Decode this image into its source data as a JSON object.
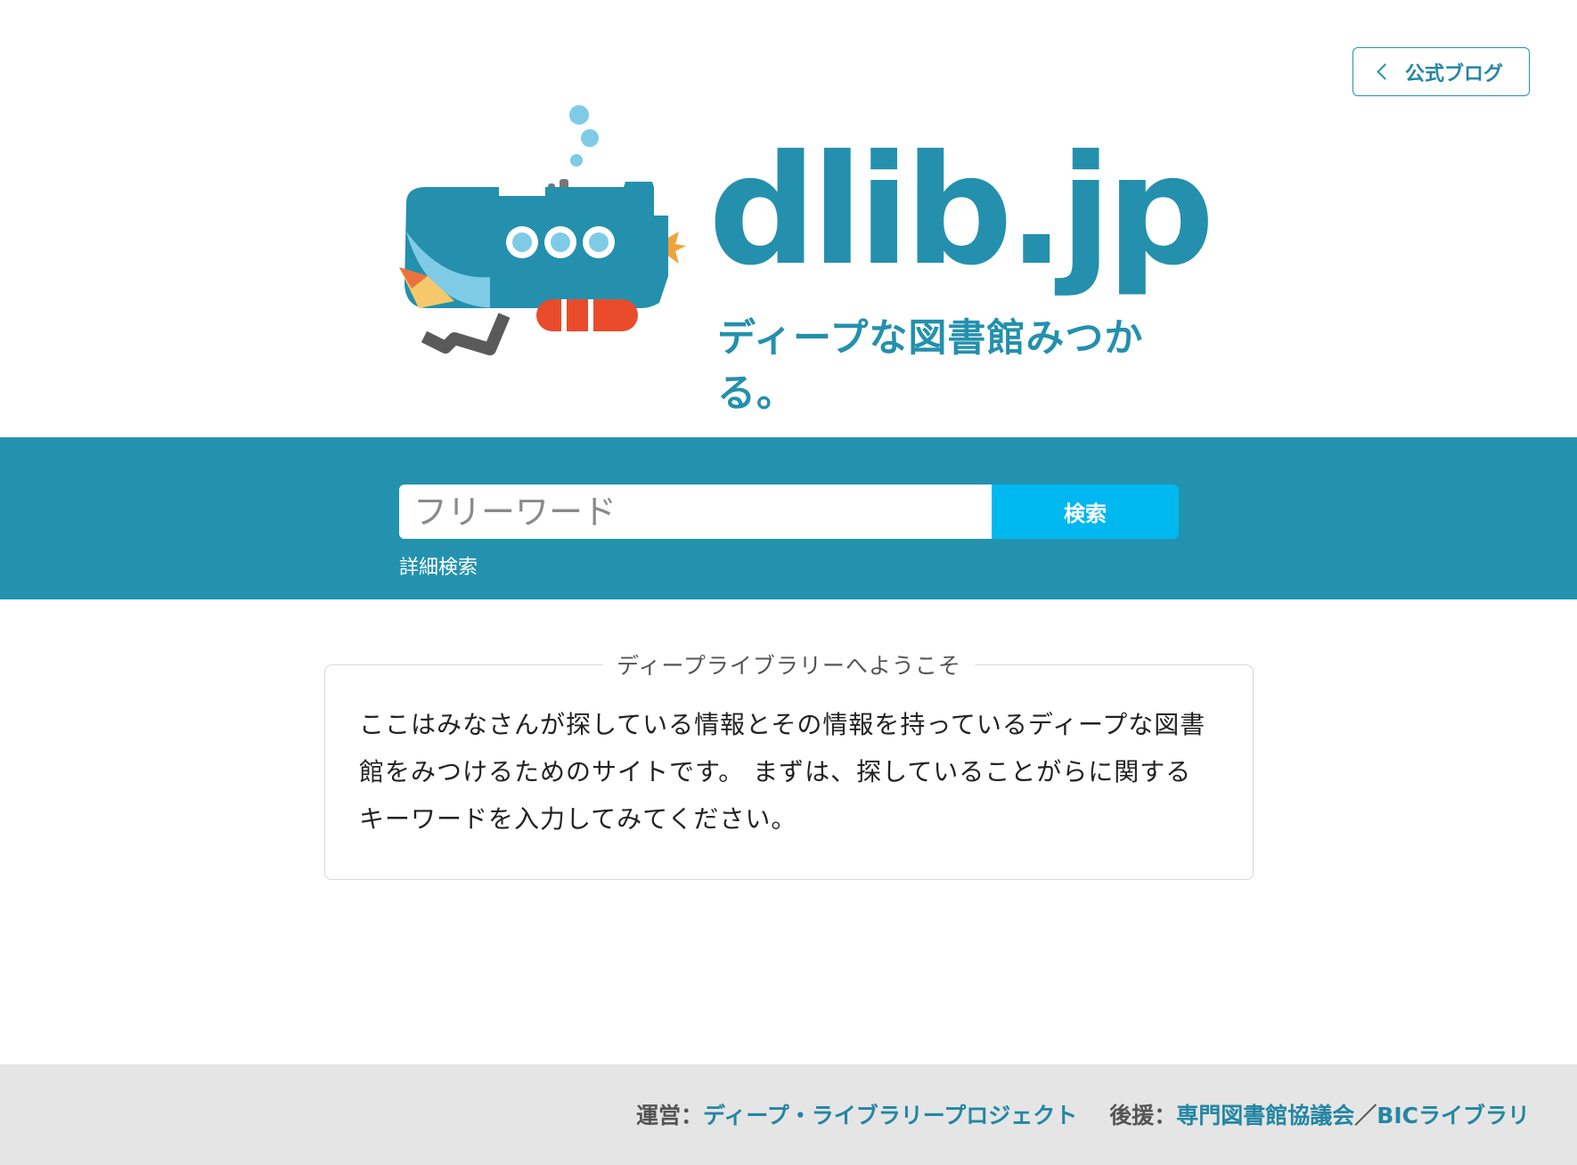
{
  "header": {
    "blog_button_label": "公式ブログ"
  },
  "logo": {
    "wordmark": "dlib.jp",
    "tagline": "ディープな図書館みつかる。",
    "colors": {
      "primary": "#2490ad",
      "light_blue": "#7fcbe6",
      "red": "#e94b2b",
      "yellow": "#f5c96b",
      "gray": "#5a5a5a"
    }
  },
  "search": {
    "placeholder": "フリーワード",
    "value": "",
    "button_label": "検索",
    "advanced_link": "詳細検索",
    "band_color": "#2492ae",
    "button_color": "#00b8f0"
  },
  "welcome": {
    "title": "ディープライブラリーへようこそ",
    "text": "ここはみなさんが探している情報とその情報を持っているディープな図書館をみつけるためのサイトです。 まずは、探していることがらに関するキーワードを入力してみてください。"
  },
  "footer": {
    "operator_label": "運営：",
    "operator_link": "ディープ・ライブラリープロジェクト",
    "support_label": "後援：",
    "support_link_1": "専門図書館協議会",
    "separator": "／",
    "support_link_2": "BICライブラリ"
  }
}
